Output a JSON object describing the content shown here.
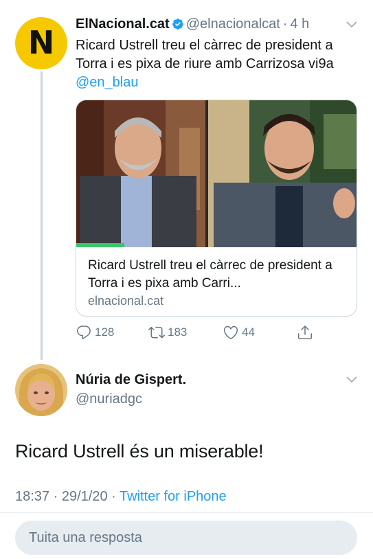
{
  "tweet1": {
    "avatar_letter": "N",
    "display_name": "ElNacional.cat",
    "handle": "@elnacionalcat",
    "separator": "·",
    "time": "4 h",
    "text": "Ricard Ustrell treu el càrrec de president a Torra i es pixa de riure amb Carrizosa vi9a ",
    "mention": "@en_blau",
    "card": {
      "title": "Ricard Ustrell treu el càrrec de president a Torra i es pixa amb Carri...",
      "domain": "elnacional.cat"
    },
    "actions": {
      "replies": "128",
      "retweets": "183",
      "likes": "44"
    }
  },
  "tweet2": {
    "display_name": "Núria de Gispert.",
    "handle": "@nuriadgc",
    "text": "Ricard Ustrell és un miserable!",
    "time": "18:37",
    "separator1": "·",
    "date": "29/1/20",
    "separator2": "·",
    "source": "Twitter for iPhone"
  },
  "reply": {
    "placeholder": "Tuita una resposta"
  },
  "colors": {
    "accent": "#1da1f2",
    "secondary_text": "#657786",
    "primary_text": "#14171a",
    "brand_yellow": "#f5c800"
  },
  "icons": [
    "verified-icon",
    "chevron-down-icon",
    "reply-icon",
    "retweet-icon",
    "like-icon",
    "share-icon"
  ]
}
